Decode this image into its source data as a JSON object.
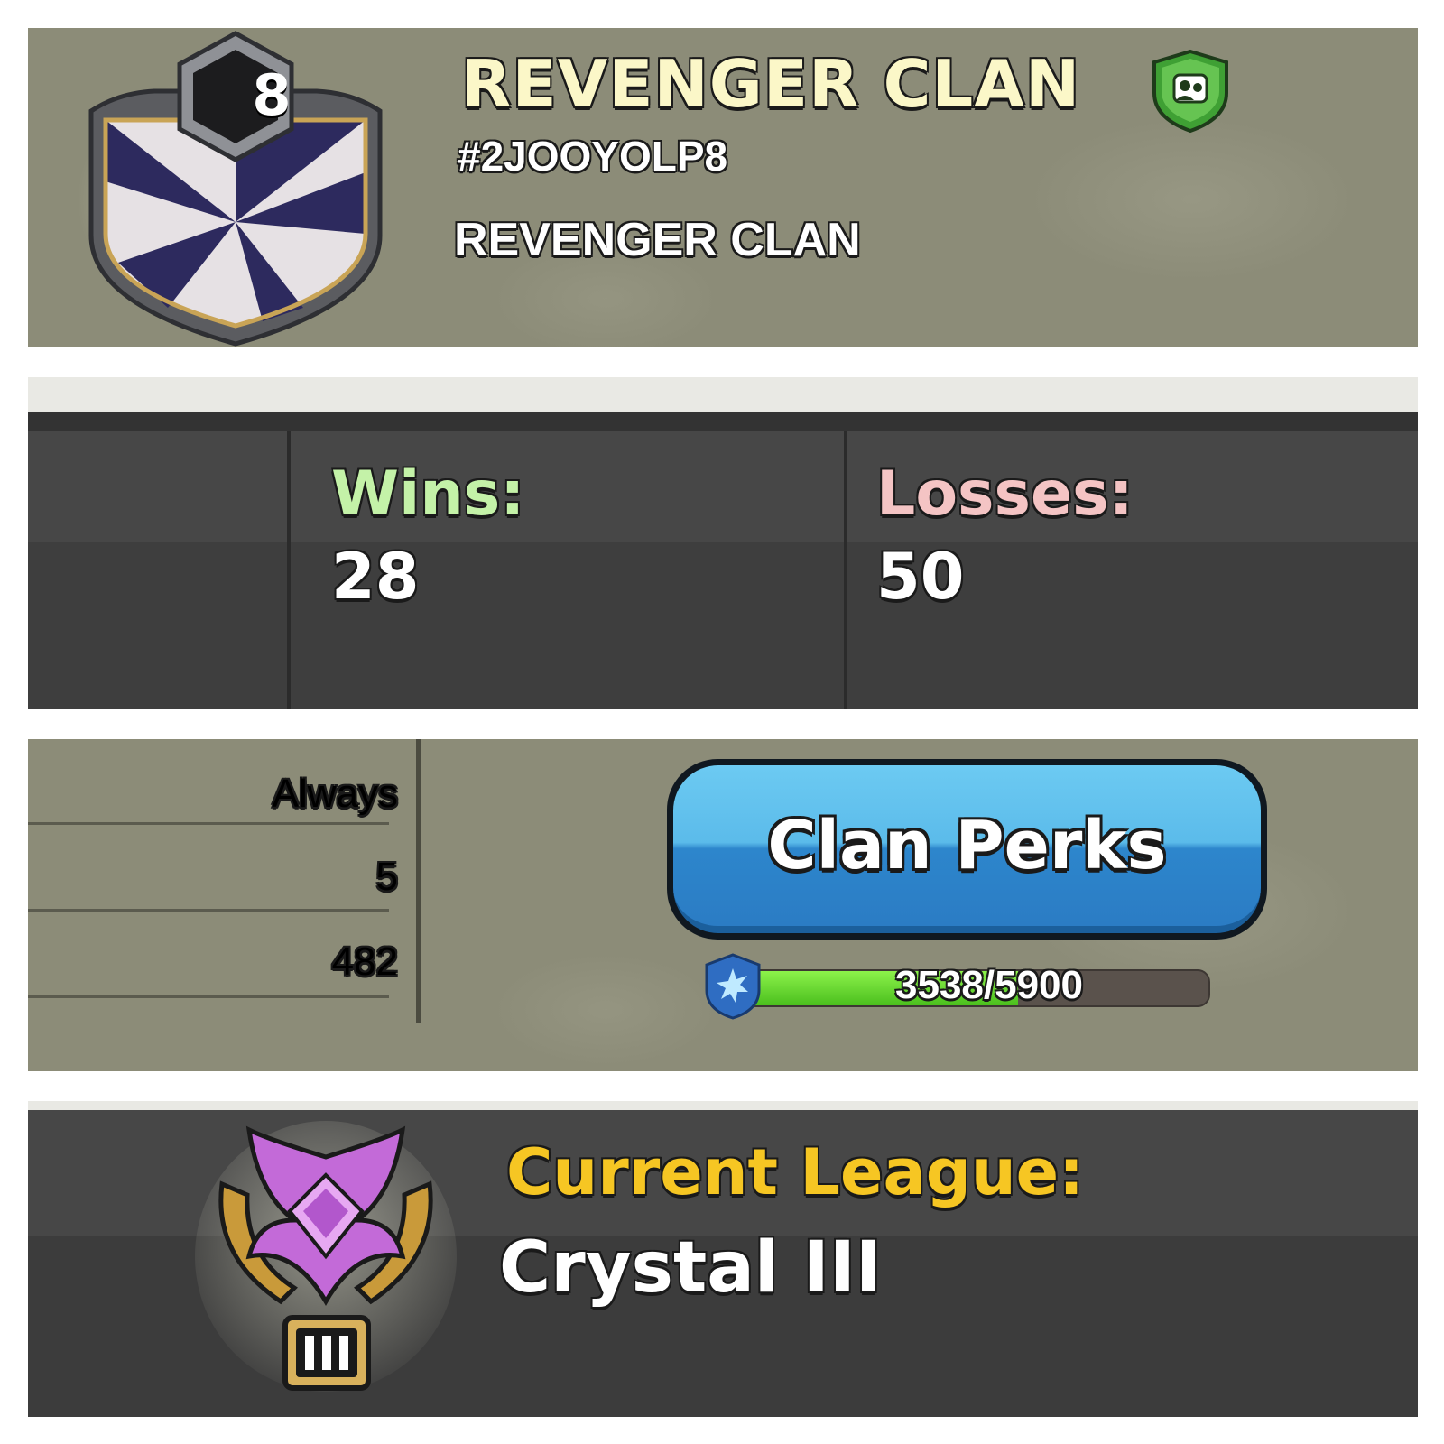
{
  "clan": {
    "level": "8",
    "name": "REVENGER CLAN",
    "tag": "#2JOOYOLP8",
    "description": "REVENGER CLAN",
    "badge_colors": {
      "primary": "#2d2a5e",
      "secondary": "#e6e1e4"
    }
  },
  "war_stats": {
    "wins_label": "Wins:",
    "wins": "28",
    "losses_label": "Losses:",
    "losses": "50",
    "wins_color": "#c4f2a8",
    "losses_color": "#f4c4c4"
  },
  "clan_info_rows": [
    "Always",
    "5",
    "482"
  ],
  "clan_perks": {
    "button_label": "Clan Perks",
    "xp_current": 3538,
    "xp_max": 5900,
    "xp_text": "3538/5900"
  },
  "league": {
    "label": "Current League:",
    "value": "Crystal III",
    "tier_numeral": "III",
    "accent_color": "#f6c623",
    "crystal_color": "#c36ad8"
  },
  "icons": {
    "verified": "verified-clan-shield-icon",
    "xp": "clan-xp-shield-icon",
    "league": "crystal-league-icon",
    "badge": "clan-badge-icon"
  }
}
